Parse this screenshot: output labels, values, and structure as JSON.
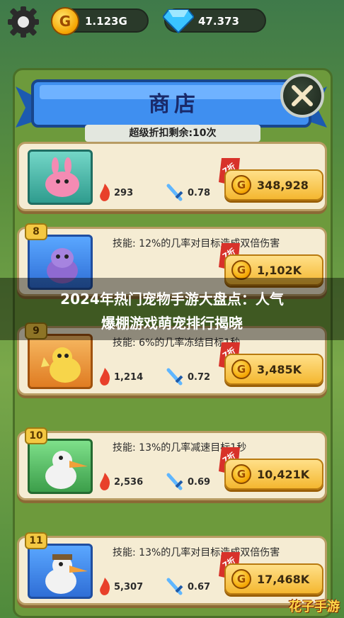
{
  "resources": {
    "gold": "1.123G",
    "gems": "47.373"
  },
  "shop": {
    "title": "商店",
    "discount_remaining": "超级折扣剩余:10次"
  },
  "items": [
    {
      "level": "",
      "skill": "",
      "discount": "7折",
      "price": "348,928",
      "attack": "293",
      "speed": "0.78"
    },
    {
      "level": "8",
      "skill": "技能: 12%的几率对目标造成双倍伤害",
      "discount": "7折",
      "price": "1,102K",
      "attack": "",
      "speed": ""
    },
    {
      "level": "9",
      "skill": "技能: 6%的几率冻结目标1秒",
      "discount": "7折",
      "price": "3,485K",
      "attack": "1,214",
      "speed": "0.72"
    },
    {
      "level": "10",
      "skill": "技能: 13%的几率减速目标1秒",
      "discount": "7折",
      "price": "10,421K",
      "attack": "2,536",
      "speed": "0.69"
    },
    {
      "level": "11",
      "skill": "技能: 13%的几率对目标造成双倍伤害",
      "discount": "7折",
      "price": "17,468K",
      "attack": "5,307",
      "speed": "0.67"
    }
  ],
  "overlay": {
    "line1": "2024年热门宠物手游大盘点：人气",
    "line2": "爆棚游戏萌宠排行揭晓"
  },
  "watermark": "花子手游",
  "colors": {
    "accent_blue": "#2f6ed6",
    "price_gold": "#f4b730",
    "card_bg": "#f5ecd3"
  }
}
